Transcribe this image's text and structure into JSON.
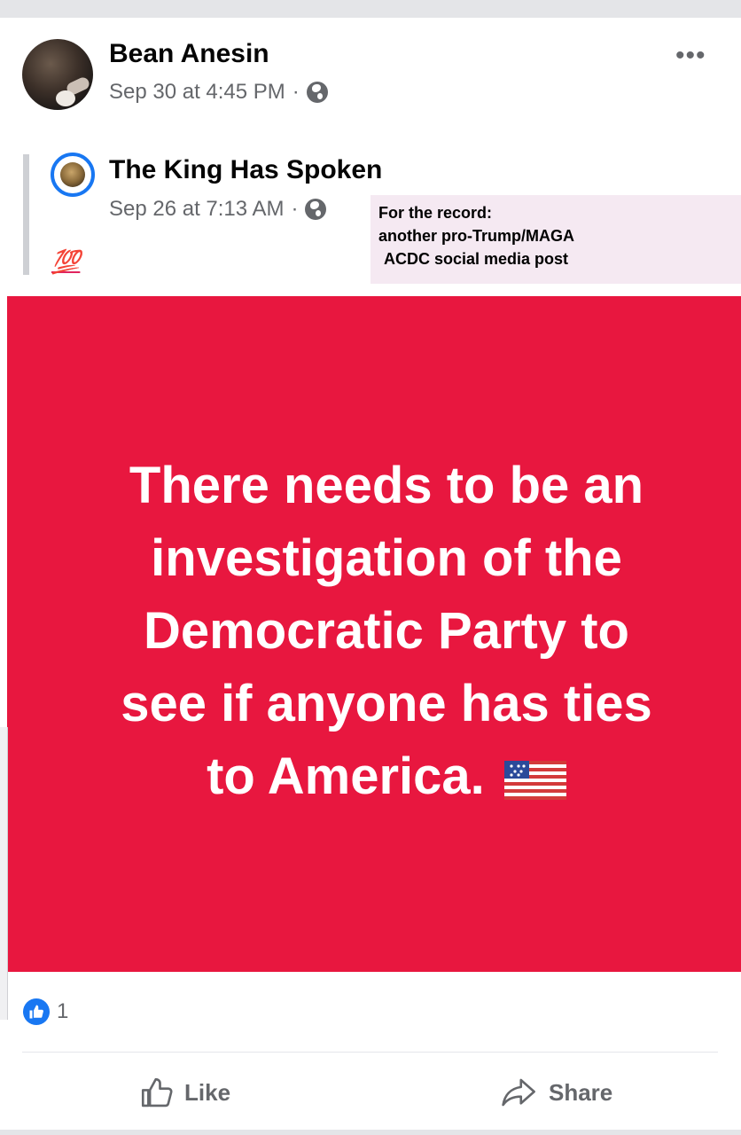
{
  "post": {
    "author": "Bean Anesin",
    "timestamp": "Sep 30 at 4:45 PM",
    "separator": "·",
    "more_label": "•••"
  },
  "shared": {
    "page_name": "The King Has Spoken",
    "timestamp": "Sep 26 at 7:13 AM",
    "separator": "·",
    "caption": "💯"
  },
  "note": {
    "line1": "For the record:",
    "line2": "another pro-Trump/MAGA",
    "line3": "ACDC social media post"
  },
  "meme": {
    "line1": "There needs to be an",
    "line2": "investigation of the",
    "line3": "Democratic Party to",
    "line4": "see if anyone has ties",
    "line5": "to America.",
    "background_color": "#e8173f"
  },
  "reactions": {
    "like_count": "1"
  },
  "actions": {
    "like_label": "Like",
    "share_label": "Share"
  },
  "icons": [
    "globe-icon",
    "more-icon",
    "like-reaction-icon",
    "thumbs-up-icon",
    "share-arrow-icon",
    "us-flag-icon"
  ]
}
